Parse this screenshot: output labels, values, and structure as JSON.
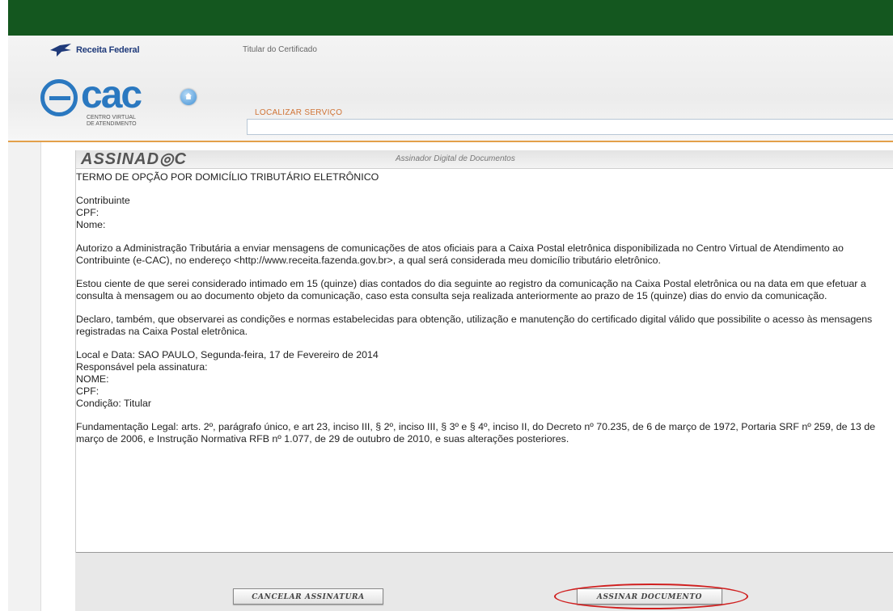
{
  "header": {
    "brand": "Receita Federal",
    "section_title": "Titular do Certificado",
    "ecac_word": "cac",
    "ecac_sub1": "Centro Virtual",
    "ecac_sub2": "de Atendimento",
    "search_label": "LOCALIZAR SERVIÇO",
    "search_value": ""
  },
  "banner": {
    "logo": "ASSINAD◎C",
    "subtitle": "Assinador Digital de Documentos"
  },
  "document": {
    "title": "TERMO DE OPÇÃO POR DOMICÍLIO TRIBUTÁRIO ELETRÔNICO",
    "contribuinte": "Contribuinte",
    "cpf": "CPF:",
    "nome": "Nome:",
    "para1": "Autorizo a Administração Tributária a enviar mensagens de comunicações de atos oficiais para a Caixa Postal eletrônica disponibilizada no Centro Virtual de Atendimento ao Contribuinte (e-CAC), no endereço <http://www.receita.fazenda.gov.br>, a qual será considerada meu domicílio tributário eletrônico.",
    "para2": "Estou ciente de que serei considerado intimado em 15 (quinze) dias contados do dia seguinte ao registro da comunicação na Caixa Postal eletrônica ou na data em que efetuar a consulta à mensagem ou ao documento objeto da comunicação, caso esta consulta seja realizada anteriormente ao prazo de 15 (quinze) dias do envio da comunicação.",
    "para3": "Declaro, também, que observarei as condições e normas estabelecidas para obtenção, utilização e manutenção do certificado digital válido que possibilite o acesso às mensagens registradas na Caixa Postal eletrônica.",
    "local_data": "Local e Data: SAO PAULO, Segunda-feira, 17 de Fevereiro de 2014",
    "responsavel": "Responsável pela assinatura:",
    "nome2": "NOME:",
    "cpf2": "CPF:",
    "condicao": "Condição: Titular",
    "fundamentacao": "Fundamentação Legal: arts. 2º, parágrafo único, e art 23, inciso III, § 2º, inciso III, § 3º e § 4º, inciso II, do Decreto nº 70.235, de 6 de março de 1972, Portaria SRF nº 259, de 13 de março de 2006, e Instrução Normativa RFB nº 1.077, de 29 de outubro de 2010, e suas alterações posteriores."
  },
  "buttons": {
    "cancel": "CANCELAR ASSINATURA",
    "sign": "ASSINAR DOCUMENTO"
  },
  "colors": {
    "topbar": "#14571f",
    "accent": "#e3a04a",
    "ecac_blue": "#2a78c0",
    "highlight": "#d01f1f"
  }
}
